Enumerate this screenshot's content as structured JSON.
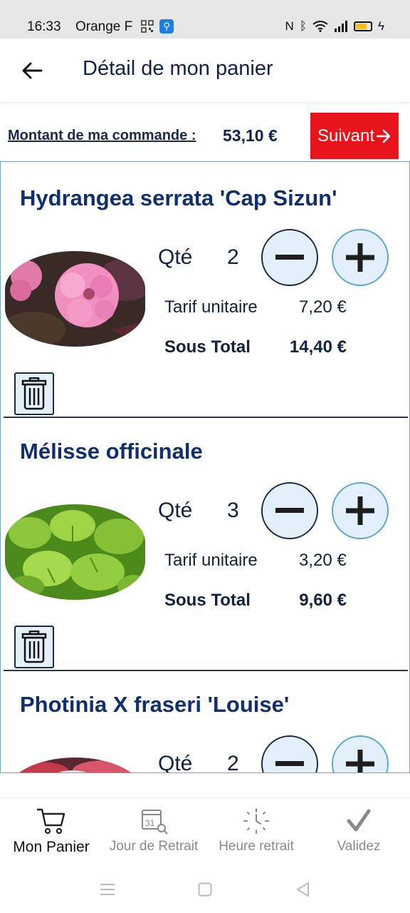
{
  "status_bar": {
    "time": "16:33",
    "carrier": "Orange F",
    "icons": [
      "qr-code-icon",
      "app-badge-icon",
      "nfc-icon",
      "bluetooth-icon",
      "wifi-icon",
      "signal-icon",
      "battery-icon"
    ]
  },
  "header": {
    "title": "Détail de mon panier",
    "back_icon": "arrow-left-icon"
  },
  "order": {
    "label": "Montant de ma commande :",
    "amount": "53,10 €",
    "next_label": "Suivant",
    "next_color": "#e8141c"
  },
  "cart": {
    "items": [
      {
        "name": "Hydrangea serrata 'Cap Sizun'",
        "qty_label": "Qté",
        "qty": "2",
        "tarif_label": "Tarif unitaire",
        "unit_price": "7,20 €",
        "subtotal_label": "Sous Total",
        "subtotal": "14,40 €",
        "photo": "pink-hydrangea-photo"
      },
      {
        "name": "Mélisse officinale",
        "qty_label": "Qté",
        "qty": "3",
        "tarif_label": "Tarif unitaire",
        "unit_price": "3,20 €",
        "subtotal_label": "Sous Total",
        "subtotal": "9,60 €",
        "photo": "lemon-balm-photo"
      },
      {
        "name": "Photinia X fraseri 'Louise'",
        "qty_label": "Qté",
        "qty": "2",
        "photo": "photinia-photo"
      }
    ]
  },
  "bottom_nav": {
    "items": [
      {
        "label": "Mon Panier",
        "icon": "cart-icon",
        "active": true
      },
      {
        "label": "Jour de Retrait",
        "icon": "calendar-icon",
        "active": false
      },
      {
        "label": "Heure retrait",
        "icon": "clock-icon",
        "active": false
      },
      {
        "label": "Validez",
        "icon": "checkmark-icon",
        "active": false
      }
    ]
  },
  "colors": {
    "title_blue": "#0f2f6e",
    "button_fill": "#e3f0fb",
    "list_border": "#6fa7cf"
  }
}
